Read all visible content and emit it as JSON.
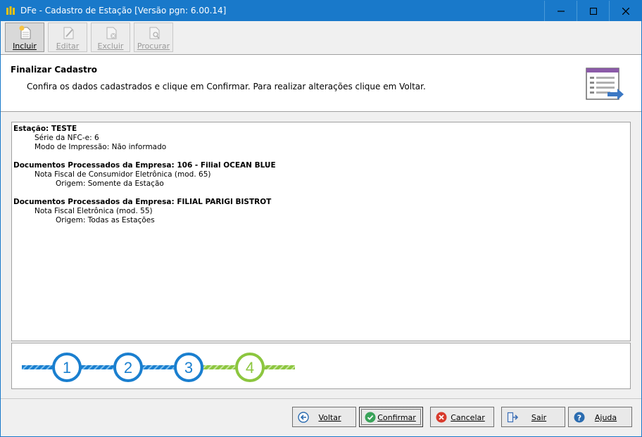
{
  "window": {
    "title": "DFe - Cadastro de Estação [Versão pgn: 6.00.14]"
  },
  "toolbar": {
    "incluir": "Incluir",
    "editar": "Editar",
    "excluir": "Excluir",
    "procurar": "Procurar"
  },
  "header": {
    "title": "Finalizar Cadastro",
    "description": "Confira os dados cadastrados e clique em Confirmar. Para realizar alterações clique em Voltar."
  },
  "summary": {
    "station": "Estação: TESTE",
    "serie": "Série da NFC-e: 6",
    "modo": "Modo de Impressão: Não informado",
    "empresa1": "Documentos Processados da Empresa: 106 - Filial OCEAN BLUE",
    "empresa1_doc": "Nota Fiscal de Consumidor Eletrônica (mod. 65)",
    "empresa1_origem": "Origem: Somente da Estação",
    "empresa2": "Documentos Processados da Empresa: FILIAL PARIGI BISTROT",
    "empresa2_doc": "Nota Fiscal Eletrônica (mod. 55)",
    "empresa2_origem": "Origem: Todas as Estações"
  },
  "steps": {
    "labels": [
      "1",
      "2",
      "3",
      "4"
    ],
    "current": 4,
    "done_color": "#1a7fcf",
    "current_color": "#8cc63f"
  },
  "buttons": {
    "voltar": "Voltar",
    "confirmar": "Confirmar",
    "cancelar": "Cancelar",
    "sair": "Sair",
    "ajuda": "Ajuda"
  }
}
